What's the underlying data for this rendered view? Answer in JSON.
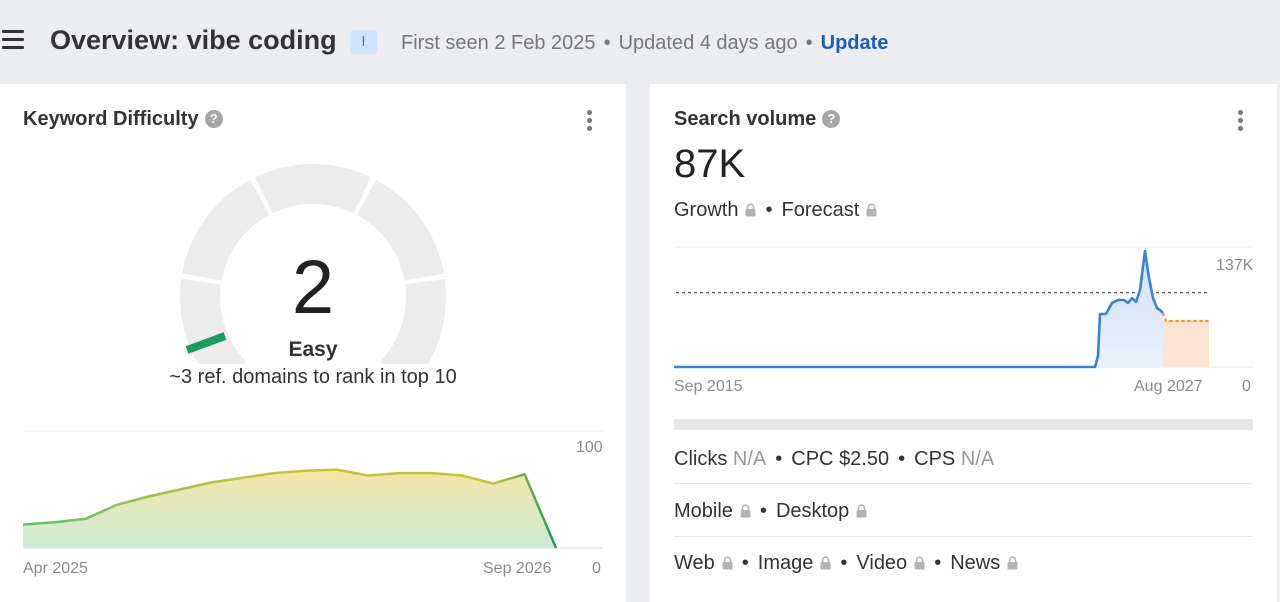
{
  "header": {
    "title": "Overview: vibe coding",
    "intent_badge": "I",
    "first_seen": "First seen 2 Feb 2025",
    "updated": "Updated 4 days ago",
    "update_label": "Update"
  },
  "keyword_difficulty": {
    "title": "Keyword Difficulty",
    "value": "2",
    "label": "Easy",
    "note": "~3 ref. domains to rank in top 10",
    "gauge_color": "#1a9c5b",
    "chart_data": {
      "type": "area",
      "x_start": "Apr 2025",
      "x_end": "Sep 2026",
      "y_max": "100",
      "y_min": "0",
      "ylim": [
        0,
        100
      ],
      "values": [
        20,
        22,
        25,
        37,
        44,
        50,
        56,
        60,
        64,
        66,
        67,
        62,
        64,
        64,
        62,
        55,
        63,
        0
      ]
    }
  },
  "search_volume": {
    "title": "Search volume",
    "value": "87K",
    "growth_label": "Growth",
    "forecast_label": "Forecast",
    "chart_data": {
      "type": "area",
      "x_start": "Sep 2015",
      "x_end": "Aug 2027",
      "y_max": "137K",
      "y_min": "0",
      "dashed_line_fraction": 0.62,
      "history_color": "#3b82cf",
      "forecast_color": "#f08a24"
    },
    "metrics": {
      "clicks_label": "Clicks",
      "clicks_value": "N/A",
      "cpc_label": "CPC",
      "cpc_value": "$2.50",
      "cps_label": "CPS",
      "cps_value": "N/A"
    },
    "devices": {
      "mobile": "Mobile",
      "desktop": "Desktop"
    },
    "sources": {
      "web": "Web",
      "image": "Image",
      "video": "Video",
      "news": "News"
    }
  }
}
